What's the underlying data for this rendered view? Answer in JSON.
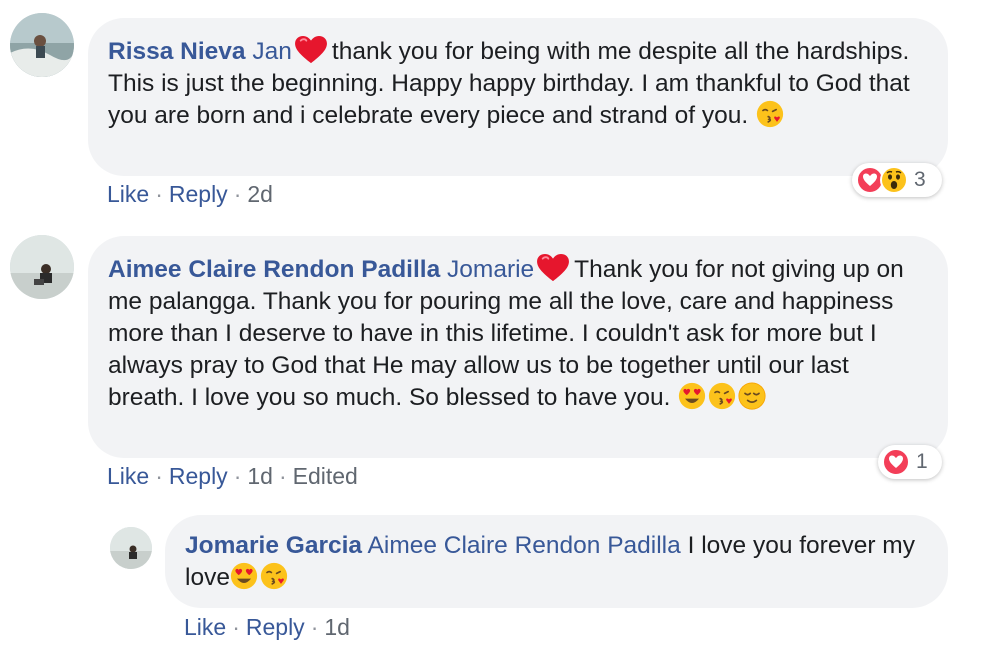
{
  "comments": [
    {
      "author": "Rissa Nieva",
      "mention": "Jan",
      "text": "thank you for being with me despite all the hardships. This is just the beginning. Happy happy birthday. I am thankful to God that you are born and i celebrate every piece and strand of you.",
      "like": "Like",
      "reply": "Reply",
      "time": "2d",
      "reaction_count": "3"
    },
    {
      "author": "Aimee Claire Rendon Padilla",
      "mention": "Jomarie",
      "text": "Thank you for not giving up on me palangga. Thank you for pouring me all the love, care and happiness more than I deserve to have in this lifetime. I couldn't ask for more but I always pray to God that He may allow us to be together until our last breath. I love you so much. So blessed to have you.",
      "like": "Like",
      "reply": "Reply",
      "time": "1d",
      "edited": "Edited",
      "reaction_count": "1"
    }
  ],
  "reply": {
    "author": "Jomarie Garcia",
    "mention": "Aimee Claire Rendon Padilla",
    "text": "I love you forever my love",
    "like": "Like",
    "reply": "Reply",
    "time": "1d"
  },
  "colors": {
    "link": "#385898",
    "bubble": "#f2f3f5",
    "meta": "#606770",
    "heart": "#f0284a",
    "love_reaction": "#f33e58"
  }
}
